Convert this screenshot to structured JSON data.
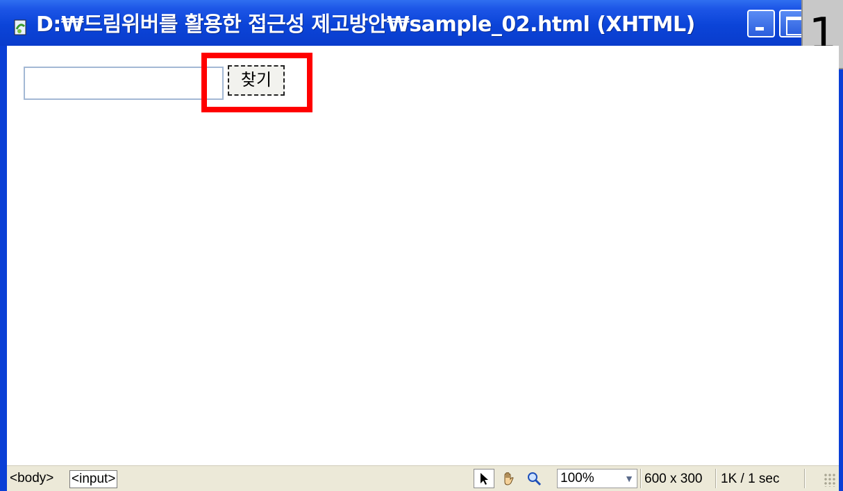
{
  "window": {
    "title": "D:₩드림위버를 활용한 접근성 제고방안₩sample_02.html (XHTML)",
    "step_badge": "1",
    "icon": "dreamweaver-document-icon"
  },
  "content": {
    "search_input_value": "",
    "find_button_label": "찾기"
  },
  "statusbar": {
    "tags": [
      "<body>",
      "<input>"
    ],
    "tools": [
      "pointer-icon",
      "hand-icon",
      "zoom-icon"
    ],
    "zoom_level": "100%",
    "window_size": "600 x 300",
    "download_stats": "1K / 1 sec"
  },
  "colors": {
    "titlebar": "#0b44d8",
    "highlight": "#ff0000",
    "statusbar": "#ece9d8"
  }
}
